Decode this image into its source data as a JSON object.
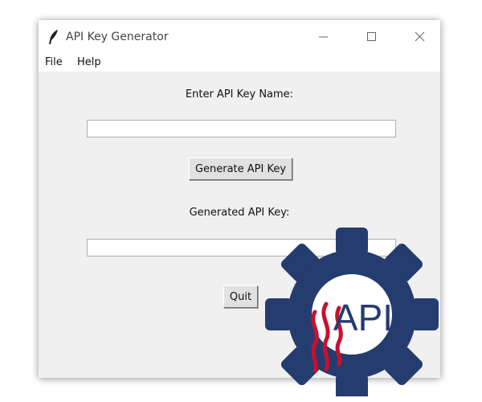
{
  "window": {
    "title": "API Key Generator",
    "controls": {
      "minimize": "minimize-icon",
      "maximize": "maximize-icon",
      "close": "close-icon"
    }
  },
  "menu": {
    "items": [
      {
        "label": "File"
      },
      {
        "label": "Help"
      }
    ]
  },
  "form": {
    "name_label": "Enter API Key Name:",
    "name_value": "",
    "generate_button": "Generate API Key",
    "key_label": "Generated API Key:",
    "key_value": "",
    "quit_button": "Quit"
  },
  "logo": {
    "text": "API",
    "gear_color": "#253c6e",
    "inner_color": "#ffffff",
    "flame_color": "#c8102e"
  },
  "colors": {
    "window_bg": "#f0f0f0",
    "titlebar_bg": "#ffffff"
  }
}
